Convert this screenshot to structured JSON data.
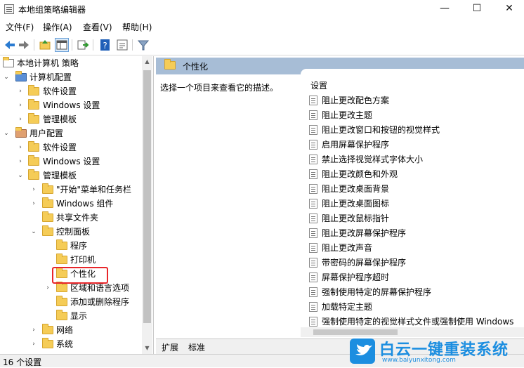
{
  "window": {
    "title": "本地组策略编辑器",
    "buttons": [
      "—",
      "☐",
      "✕"
    ]
  },
  "menu": [
    "文件(F)",
    "操作(A)",
    "查看(V)",
    "帮助(H)"
  ],
  "toolbar_icons": [
    "back-arrow-icon",
    "forward-arrow-icon",
    "up-folder-icon",
    "show-tree-icon",
    "export-icon",
    "help-icon",
    "properties-icon",
    "filter-icon"
  ],
  "tree": {
    "items": [
      {
        "label": "本地计算机 策略"
      },
      {
        "label": "计算机配置"
      },
      {
        "label": "软件设置"
      },
      {
        "label": "Windows 设置"
      },
      {
        "label": "管理模板"
      },
      {
        "label": "用户配置"
      },
      {
        "label": "软件设置"
      },
      {
        "label": "Windows 设置"
      },
      {
        "label": "管理模板"
      },
      {
        "label": "\"开始\"菜单和任务栏"
      },
      {
        "label": "Windows 组件"
      },
      {
        "label": "共享文件夹"
      },
      {
        "label": "控制面板"
      },
      {
        "label": "程序"
      },
      {
        "label": "打印机"
      },
      {
        "label": "个性化"
      },
      {
        "label": "区域和语言选项"
      },
      {
        "label": "添加或删除程序"
      },
      {
        "label": "显示"
      },
      {
        "label": "网络"
      },
      {
        "label": "系统"
      }
    ]
  },
  "right": {
    "header": "个性化",
    "description": "选择一个项目来查看它的描述。",
    "column_header": "设置",
    "settings": [
      "阻止更改配色方案",
      "阻止更改主题",
      "阻止更改窗口和按钮的视觉样式",
      "启用屏幕保护程序",
      "禁止选择视觉样式字体大小",
      "阻止更改颜色和外观",
      "阻止更改桌面背景",
      "阻止更改桌面图标",
      "阻止更改鼠标指针",
      "阻止更改屏幕保护程序",
      "阻止更改声音",
      "带密码的屏幕保护程序",
      "屏幕保护程序超时",
      "强制使用特定的屏幕保护程序",
      "加载特定主题",
      "强制使用特定的视觉样式文件或强制使用 Windows"
    ]
  },
  "tabs": [
    "扩展",
    "标准"
  ],
  "status": "16 个设置",
  "watermark": {
    "main": "白云一键重装系统",
    "sub": "www.baiyunxitong.com"
  },
  "colors": {
    "header_bg": "#a7bdd6",
    "highlight": "#e8262a",
    "watermark": "#1c8ee0"
  }
}
